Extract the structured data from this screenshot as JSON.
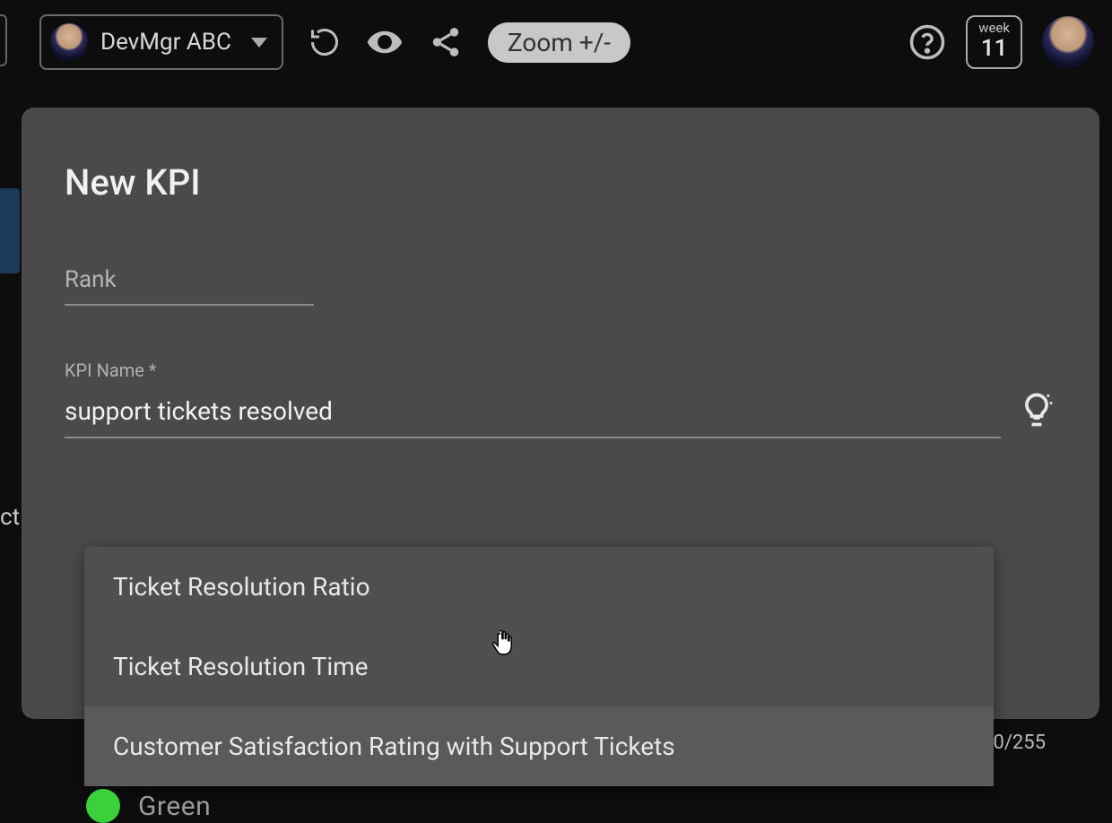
{
  "topbar": {
    "user_label": "DevMgr ABC",
    "zoom_label": "Zoom +/-",
    "week_label": "week",
    "week_number": "11"
  },
  "side_fragment": "ct",
  "modal": {
    "title": "New KPI",
    "rank_placeholder": "Rank",
    "kpi_name_label": "KPI Name *",
    "kpi_name_value": "support tickets resolved",
    "char_count": "0/255"
  },
  "suggestions": {
    "item0": "Ticket Resolution Ratio",
    "item1": "Ticket Resolution Time",
    "item2": "Customer Satisfaction Rating with Support Tickets"
  },
  "status": {
    "green_label": "Green"
  }
}
